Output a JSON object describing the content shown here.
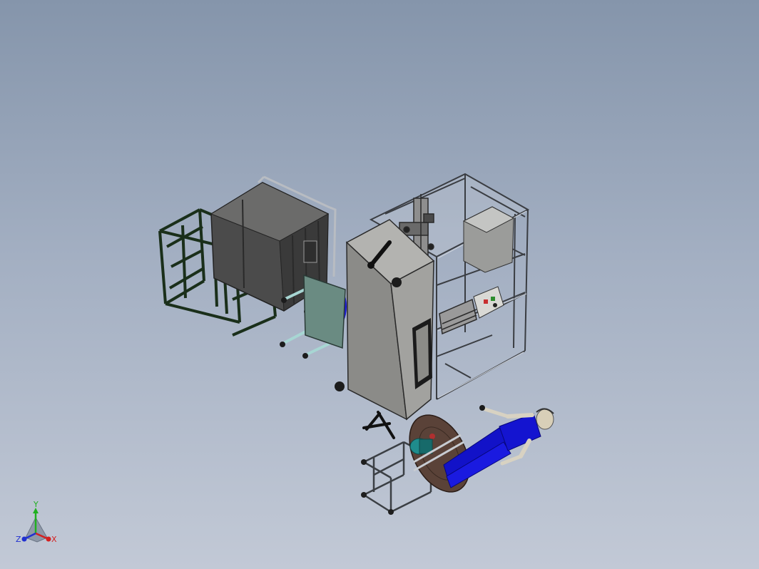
{
  "viewport": {
    "background_top": "#8595ab",
    "background_bottom": "#c2c9d6"
  },
  "model": {
    "components": [
      {
        "id": "mold-tank-assembly",
        "color": "#4a4a4a"
      },
      {
        "id": "green-support-frame",
        "color": "#1f3a1f"
      },
      {
        "id": "clamp-plate",
        "color": "#5e7f76"
      },
      {
        "id": "tie-rods",
        "color": "#9fd2cf"
      },
      {
        "id": "grey-cabinet",
        "color": "#8a8a88"
      },
      {
        "id": "open-steel-frame",
        "color": "#c9ced6"
      },
      {
        "id": "control-box",
        "color": "#d8d8d4"
      },
      {
        "id": "rotary-disc",
        "color": "#5a4238"
      },
      {
        "id": "motor",
        "color": "#1f8c8c"
      },
      {
        "id": "human-figure",
        "color": "#1010c8"
      }
    ]
  },
  "triad": {
    "y_label": "Y",
    "x_label": "X",
    "z_label": "Z",
    "x_color": "#d42020",
    "y_color": "#20b020",
    "z_color": "#2030d0"
  }
}
